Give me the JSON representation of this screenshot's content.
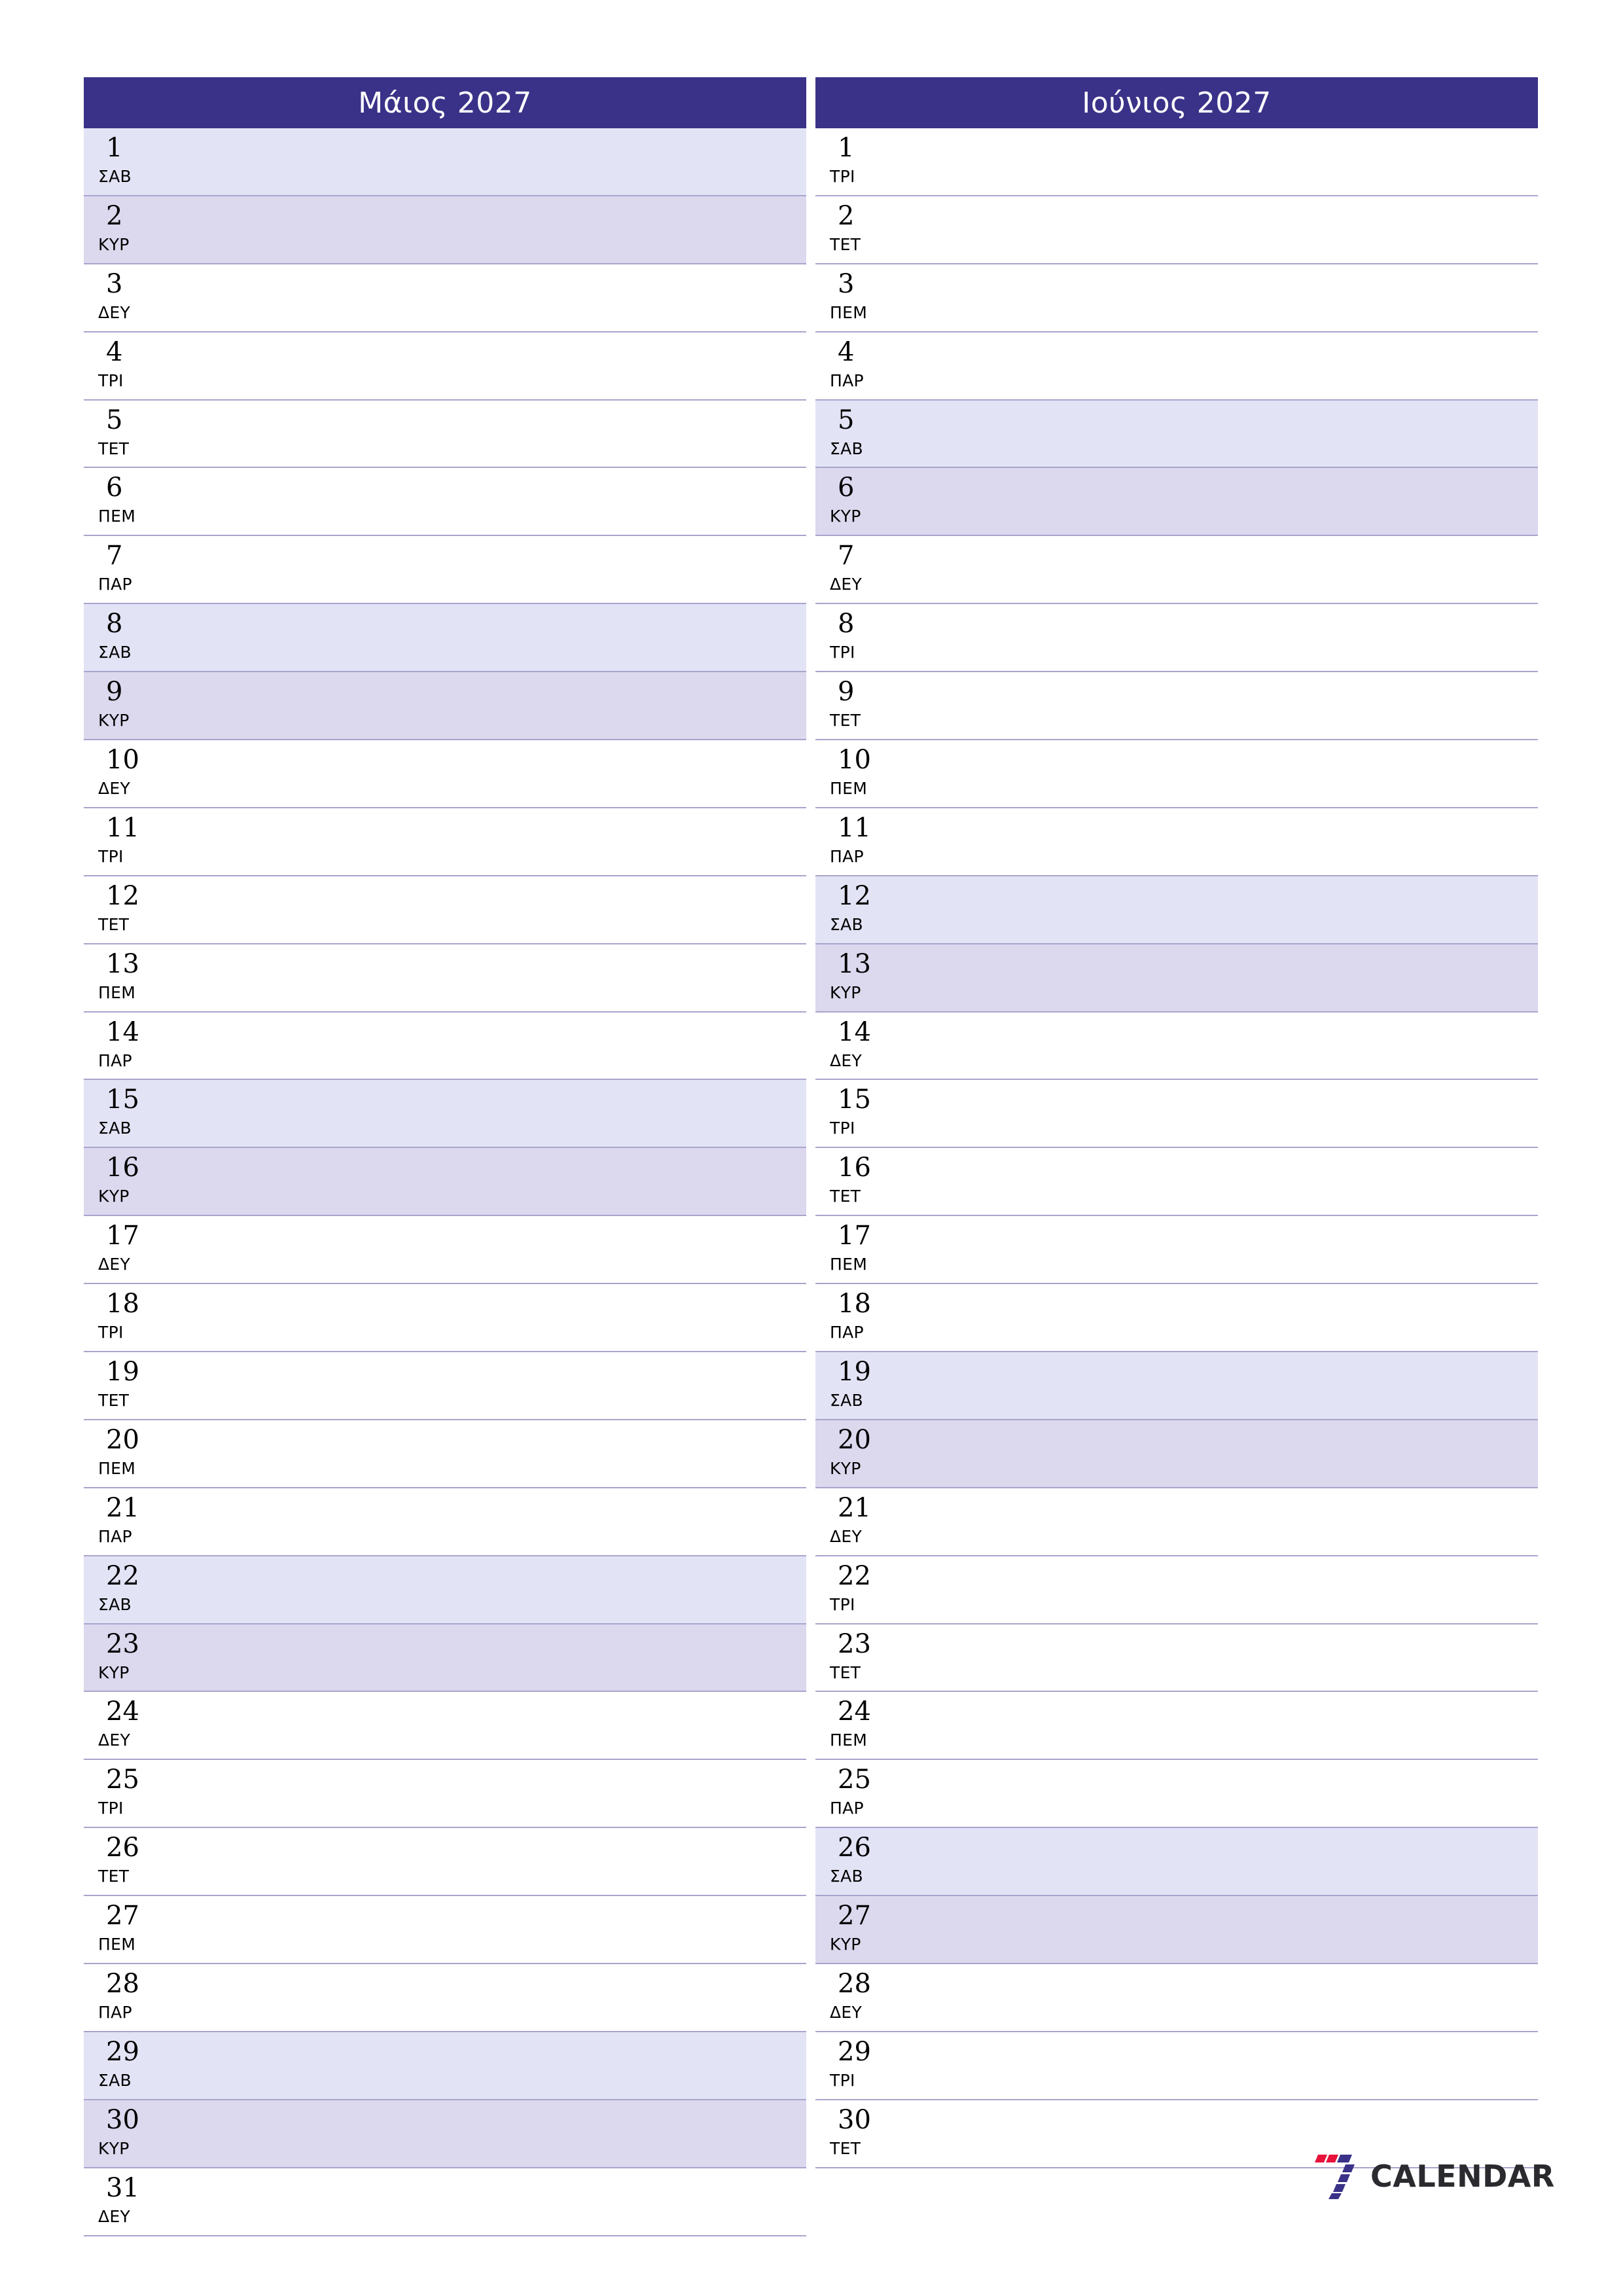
{
  "document": {
    "type": "two-month-planner",
    "year": "2027",
    "language": "el"
  },
  "colors": {
    "header_bg": "#3a3288",
    "header_text": "#ffffff",
    "saturday_bg": "#e3e3f6",
    "sunday_bg": "#dcd8ee",
    "grid_line": "#a9a4cc",
    "page_bg": "#ffffff",
    "logo_red": "#e8123b",
    "logo_blue": "#3a3288",
    "logo_text": "#2b2b2f"
  },
  "months": [
    {
      "title": "Μάιος 2027",
      "days": [
        {
          "num": "1",
          "wd": "ΣΑΒ",
          "type": "sat"
        },
        {
          "num": "2",
          "wd": "ΚΥΡ",
          "type": "sun"
        },
        {
          "num": "3",
          "wd": "ΔΕΥ",
          "type": "wd"
        },
        {
          "num": "4",
          "wd": "ΤΡΙ",
          "type": "wd"
        },
        {
          "num": "5",
          "wd": "ΤΕΤ",
          "type": "wd"
        },
        {
          "num": "6",
          "wd": "ΠΕΜ",
          "type": "wd"
        },
        {
          "num": "7",
          "wd": "ΠΑΡ",
          "type": "wd"
        },
        {
          "num": "8",
          "wd": "ΣΑΒ",
          "type": "sat"
        },
        {
          "num": "9",
          "wd": "ΚΥΡ",
          "type": "sun"
        },
        {
          "num": "10",
          "wd": "ΔΕΥ",
          "type": "wd"
        },
        {
          "num": "11",
          "wd": "ΤΡΙ",
          "type": "wd"
        },
        {
          "num": "12",
          "wd": "ΤΕΤ",
          "type": "wd"
        },
        {
          "num": "13",
          "wd": "ΠΕΜ",
          "type": "wd"
        },
        {
          "num": "14",
          "wd": "ΠΑΡ",
          "type": "wd"
        },
        {
          "num": "15",
          "wd": "ΣΑΒ",
          "type": "sat"
        },
        {
          "num": "16",
          "wd": "ΚΥΡ",
          "type": "sun"
        },
        {
          "num": "17",
          "wd": "ΔΕΥ",
          "type": "wd"
        },
        {
          "num": "18",
          "wd": "ΤΡΙ",
          "type": "wd"
        },
        {
          "num": "19",
          "wd": "ΤΕΤ",
          "type": "wd"
        },
        {
          "num": "20",
          "wd": "ΠΕΜ",
          "type": "wd"
        },
        {
          "num": "21",
          "wd": "ΠΑΡ",
          "type": "wd"
        },
        {
          "num": "22",
          "wd": "ΣΑΒ",
          "type": "sat"
        },
        {
          "num": "23",
          "wd": "ΚΥΡ",
          "type": "sun"
        },
        {
          "num": "24",
          "wd": "ΔΕΥ",
          "type": "wd"
        },
        {
          "num": "25",
          "wd": "ΤΡΙ",
          "type": "wd"
        },
        {
          "num": "26",
          "wd": "ΤΕΤ",
          "type": "wd"
        },
        {
          "num": "27",
          "wd": "ΠΕΜ",
          "type": "wd"
        },
        {
          "num": "28",
          "wd": "ΠΑΡ",
          "type": "wd"
        },
        {
          "num": "29",
          "wd": "ΣΑΒ",
          "type": "sat"
        },
        {
          "num": "30",
          "wd": "ΚΥΡ",
          "type": "sun"
        },
        {
          "num": "31",
          "wd": "ΔΕΥ",
          "type": "wd"
        }
      ]
    },
    {
      "title": "Ιούνιος 2027",
      "days": [
        {
          "num": "1",
          "wd": "ΤΡΙ",
          "type": "wd"
        },
        {
          "num": "2",
          "wd": "ΤΕΤ",
          "type": "wd"
        },
        {
          "num": "3",
          "wd": "ΠΕΜ",
          "type": "wd"
        },
        {
          "num": "4",
          "wd": "ΠΑΡ",
          "type": "wd"
        },
        {
          "num": "5",
          "wd": "ΣΑΒ",
          "type": "sat"
        },
        {
          "num": "6",
          "wd": "ΚΥΡ",
          "type": "sun"
        },
        {
          "num": "7",
          "wd": "ΔΕΥ",
          "type": "wd"
        },
        {
          "num": "8",
          "wd": "ΤΡΙ",
          "type": "wd"
        },
        {
          "num": "9",
          "wd": "ΤΕΤ",
          "type": "wd"
        },
        {
          "num": "10",
          "wd": "ΠΕΜ",
          "type": "wd"
        },
        {
          "num": "11",
          "wd": "ΠΑΡ",
          "type": "wd"
        },
        {
          "num": "12",
          "wd": "ΣΑΒ",
          "type": "sat"
        },
        {
          "num": "13",
          "wd": "ΚΥΡ",
          "type": "sun"
        },
        {
          "num": "14",
          "wd": "ΔΕΥ",
          "type": "wd"
        },
        {
          "num": "15",
          "wd": "ΤΡΙ",
          "type": "wd"
        },
        {
          "num": "16",
          "wd": "ΤΕΤ",
          "type": "wd"
        },
        {
          "num": "17",
          "wd": "ΠΕΜ",
          "type": "wd"
        },
        {
          "num": "18",
          "wd": "ΠΑΡ",
          "type": "wd"
        },
        {
          "num": "19",
          "wd": "ΣΑΒ",
          "type": "sat"
        },
        {
          "num": "20",
          "wd": "ΚΥΡ",
          "type": "sun"
        },
        {
          "num": "21",
          "wd": "ΔΕΥ",
          "type": "wd"
        },
        {
          "num": "22",
          "wd": "ΤΡΙ",
          "type": "wd"
        },
        {
          "num": "23",
          "wd": "ΤΕΤ",
          "type": "wd"
        },
        {
          "num": "24",
          "wd": "ΠΕΜ",
          "type": "wd"
        },
        {
          "num": "25",
          "wd": "ΠΑΡ",
          "type": "wd"
        },
        {
          "num": "26",
          "wd": "ΣΑΒ",
          "type": "sat"
        },
        {
          "num": "27",
          "wd": "ΚΥΡ",
          "type": "sun"
        },
        {
          "num": "28",
          "wd": "ΔΕΥ",
          "type": "wd"
        },
        {
          "num": "29",
          "wd": "ΤΡΙ",
          "type": "wd"
        },
        {
          "num": "30",
          "wd": "ΤΕΤ",
          "type": "wd"
        }
      ]
    }
  ],
  "logo": {
    "mark": "seven-stripes-icon",
    "text": "CALENDAR"
  }
}
